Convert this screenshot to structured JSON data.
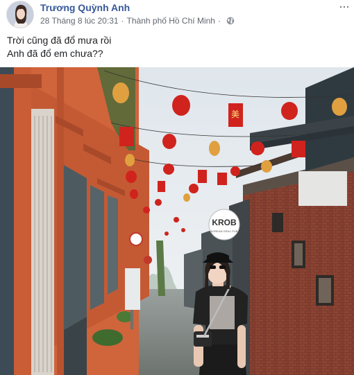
{
  "post": {
    "author": "Trương Quỳnh Anh",
    "date": "28 Tháng 8 lúc 20:31",
    "separator": "·",
    "location": "Thành phố Hồ Chí Minh",
    "privacy_icon": "globe-icon",
    "text_lines": [
      "Trời cũng đã đổ mưa rồi",
      "Anh đã đổ em chưa??"
    ],
    "more_label": "···"
  },
  "photo": {
    "sign_brand": "KROB",
    "sign_subtitle": "KOREAN GRILL PUB",
    "lantern_char": "美"
  },
  "colors": {
    "link": "#365899",
    "meta": "#616770"
  }
}
